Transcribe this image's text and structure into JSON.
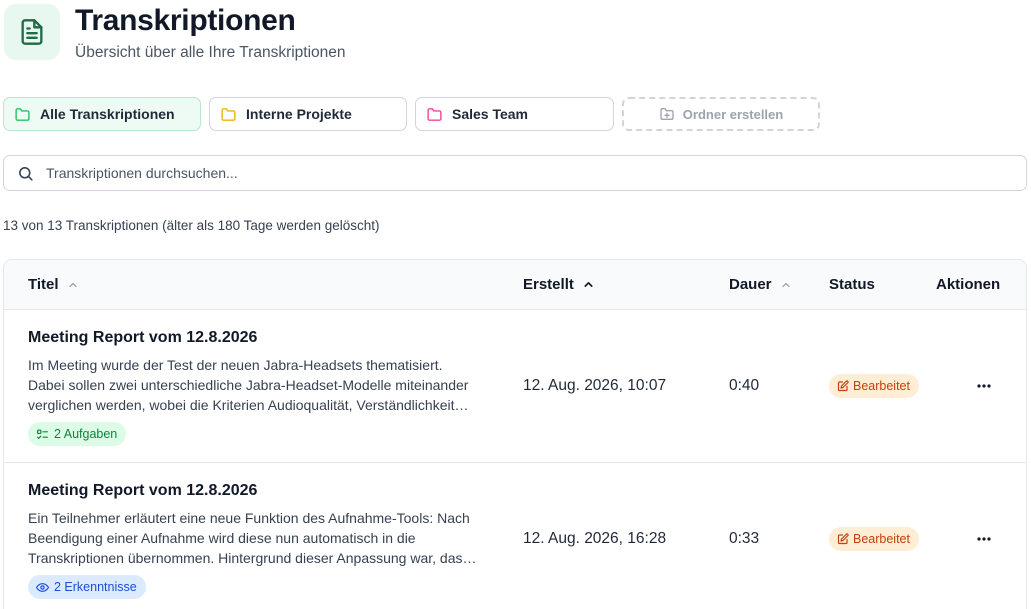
{
  "header": {
    "title": "Transkriptionen",
    "subtitle": "Übersicht über alle Ihre Transkriptionen",
    "icon": "document-icon"
  },
  "folders": [
    {
      "label": "Alle Transkriptionen",
      "color": "#22c55e",
      "active": true
    },
    {
      "label": "Interne Projekte",
      "color": "#eab308",
      "active": false
    },
    {
      "label": "Sales Team",
      "color": "#ec4899",
      "active": false
    }
  ],
  "create_folder_label": "Ordner erstellen",
  "search": {
    "placeholder": "Transkriptionen durchsuchen...",
    "value": ""
  },
  "count_text": "13 von 13 Transkriptionen (älter als 180 Tage werden gelöscht)",
  "table": {
    "columns": {
      "title": "Titel",
      "created": "Erstellt",
      "duration": "Dauer",
      "status": "Status",
      "actions": "Aktionen"
    },
    "sort": {
      "active_column": "created",
      "direction": "asc"
    },
    "rows": [
      {
        "title": "Meeting Report vom 12.8.2026",
        "summary": "Im Meeting wurde der Test der neuen Jabra-Headsets thematisiert. Dabei sollen zwei unterschiedliche Jabra-Headset-Modelle miteinander verglichen werden, wobei die Kriterien Audioqualität, Verständlichkeit…",
        "chip": "2 Aufgaben",
        "chip_type": "tasks",
        "created": "12. Aug. 2026, 10:07",
        "duration": "0:40",
        "status": "Bearbeitet"
      },
      {
        "title": "Meeting Report vom 12.8.2026",
        "summary": "Ein Teilnehmer erläutert eine neue Funktion des Aufnahme-Tools: Nach Beendigung einer Aufnahme wird diese nun automatisch in die Transkriptionen übernommen. Hintergrund dieser Anpassung war, das…",
        "chip": "2 Erkenntnisse",
        "chip_type": "insights",
        "created": "12. Aug. 2026, 16:28",
        "duration": "0:33",
        "status": "Bearbeitet"
      }
    ]
  },
  "colors": {
    "accent": "#15803d",
    "accent_bg": "#e8f7ef",
    "status_bg": "#ffedd5",
    "status_fg": "#c2410c",
    "insight_bg": "#dbeafe",
    "insight_fg": "#1d4ed8"
  }
}
